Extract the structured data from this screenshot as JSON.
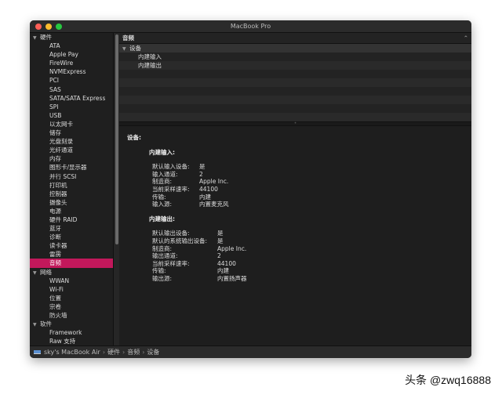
{
  "window": {
    "title": "MacBook Pro"
  },
  "sidebar": {
    "groups": [
      {
        "label": "硬件",
        "items": [
          "ATA",
          "Apple Pay",
          "FireWire",
          "NVMExpress",
          "PCI",
          "SAS",
          "SATA/SATA Express",
          "SPI",
          "USB",
          "以太网卡",
          "储存",
          "光盘刻录",
          "光纤通道",
          "内存",
          "图形卡/显示器",
          "并行 SCSI",
          "打印机",
          "控制器",
          "摄像头",
          "电源",
          "硬件 RAID",
          "蓝牙",
          "诊断",
          "读卡器",
          "雷雳",
          "音频"
        ]
      },
      {
        "label": "网络",
        "items": [
          "WWAN",
          "Wi-Fi",
          "位置",
          "宗卷",
          "防火墙"
        ]
      },
      {
        "label": "软件",
        "items": [
          "Framework",
          "Raw 支持"
        ]
      }
    ],
    "selected": "音频"
  },
  "main": {
    "header": "音频",
    "tree": {
      "group": "设备",
      "items": [
        "内建输入",
        "内建输出"
      ]
    },
    "detail": {
      "title": "设备:",
      "input": {
        "title": "内建输入:",
        "rows": [
          [
            "默认输入设备:",
            "是"
          ],
          [
            "输入通道:",
            "2"
          ],
          [
            "制造商:",
            "Apple Inc."
          ],
          [
            "当前采样速率:",
            "44100"
          ],
          [
            "传输:",
            "内建"
          ],
          [
            "输入源:",
            "内置麦克风"
          ]
        ]
      },
      "output": {
        "title": "内建输出:",
        "rows": [
          [
            "默认输出设备:",
            "是"
          ],
          [
            "默认的系统输出设备:",
            "是"
          ],
          [
            "制造商:",
            "Apple Inc."
          ],
          [
            "输出通道:",
            "2"
          ],
          [
            "当前采样速率:",
            "44100"
          ],
          [
            "传输:",
            "内建"
          ],
          [
            "输出源:",
            "内置扬声器"
          ]
        ]
      }
    }
  },
  "statusbar": {
    "path": [
      "sky's MacBook Air",
      "硬件",
      "音频",
      "设备"
    ]
  },
  "watermark": "头条 @zwq16888",
  "colors": {
    "selection": "#c2185b"
  }
}
